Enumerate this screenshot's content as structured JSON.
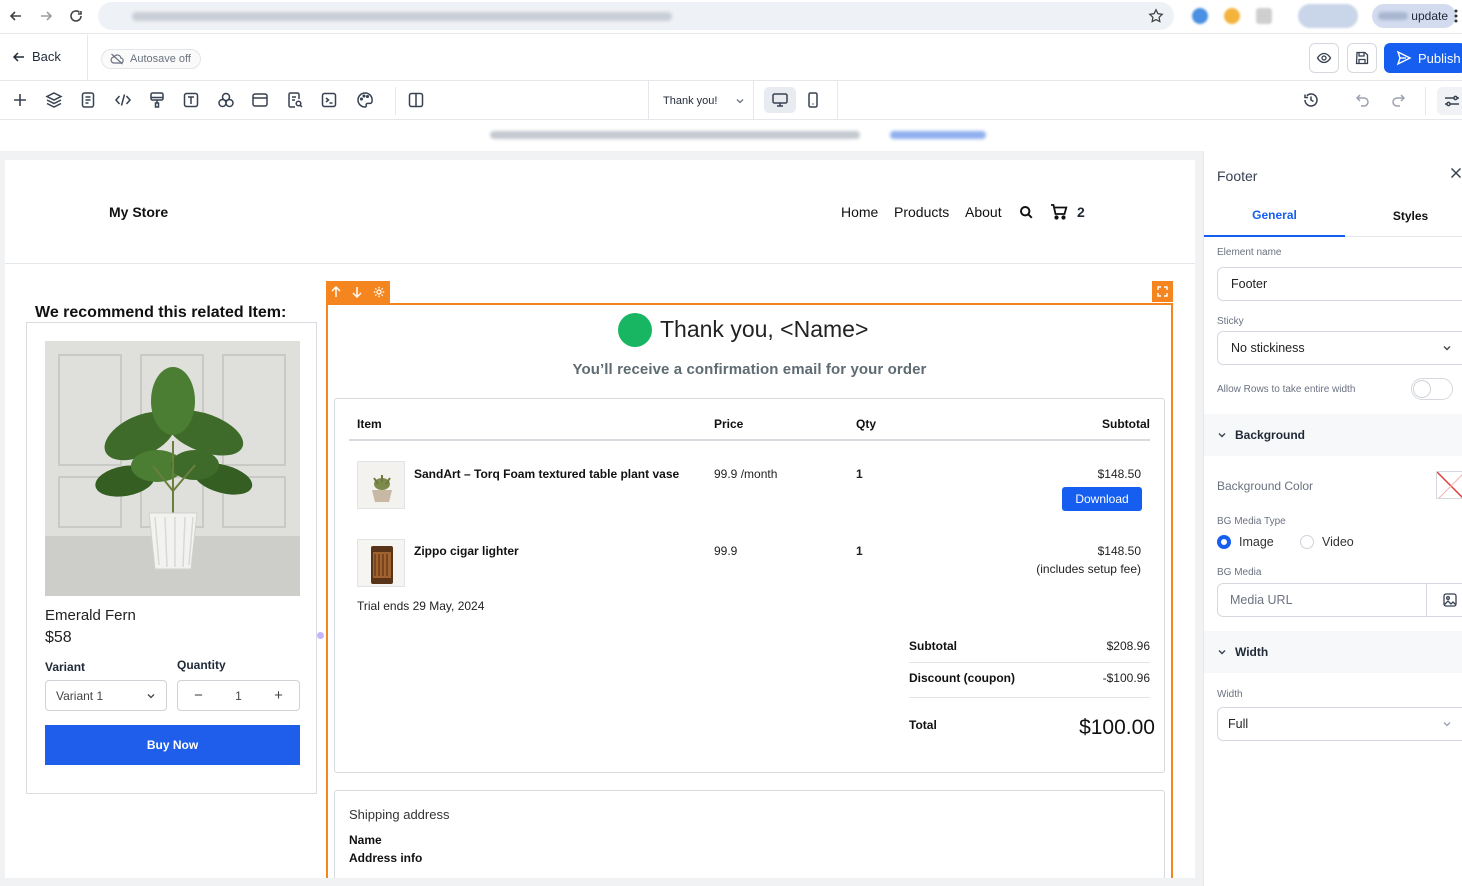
{
  "browser": {
    "update_label": "update"
  },
  "header": {
    "back_label": "Back",
    "autosave_label": "Autosave off",
    "publish_label": "Publish"
  },
  "toolbar": {
    "page_select": "Thank you!",
    "icons": [
      "plus-icon",
      "layers-icon",
      "pages-icon",
      "code-icon",
      "paint-icon",
      "text-icon",
      "elements-icon",
      "section-icon",
      "search-doc-icon",
      "terminal-icon",
      "palette-icon",
      "split-view-icon"
    ]
  },
  "site": {
    "store_name": "My Store",
    "nav": [
      "Home",
      "Products",
      "About"
    ],
    "cart_count": "2"
  },
  "recommendation": {
    "title": "We recommend this related Item:",
    "product_name": "Emerald Fern",
    "price": "$58",
    "variant_label": "Variant",
    "quantity_label": "Quantity",
    "variant_value": "Variant 1",
    "quantity_value": "1",
    "minus": "−",
    "plus": "+",
    "buy_label": "Buy Now"
  },
  "thankyou": {
    "title": "Thank you, <Name>",
    "subtitle": "You’ll receive a confirmation email for your order"
  },
  "order": {
    "headers": {
      "item": "Item",
      "price": "Price",
      "qty": "Qty",
      "subtotal": "Subtotal"
    },
    "rows": [
      {
        "name": "SandArt – Torq Foam textured table plant vase",
        "price": "99.9 /month",
        "qty": "1",
        "subtotal": "$148.50",
        "action": "Download"
      },
      {
        "name": "Zippo cigar lighter",
        "price": "99.9",
        "qty": "1",
        "subtotal": "$148.50",
        "note": "(includes setup fee)",
        "trial": "Trial ends 29 May, 2024"
      }
    ],
    "summary": {
      "subtotal_label": "Subtotal",
      "subtotal_value": "$208.96",
      "discount_label": "Discount (coupon)",
      "discount_value": "-$100.96",
      "total_label": "Total",
      "total_value": "$100.00"
    }
  },
  "shipping": {
    "title": "Shipping address",
    "name": "Name",
    "address": "Address info"
  },
  "panel": {
    "title": "Footer",
    "tabs": [
      "General",
      "Styles"
    ],
    "element_name_label": "Element name",
    "element_name_value": "Footer",
    "sticky_label": "Sticky",
    "sticky_value": "No stickiness",
    "allow_rows_label": "Allow Rows to take entire width",
    "allow_rows_on": false,
    "background_section": "Background",
    "bg_color_label": "Background Color",
    "bg_media_type_label": "BG Media Type",
    "media_types": [
      "Image",
      "Video"
    ],
    "media_type_selected": "Image",
    "bg_media_label": "BG Media",
    "media_url_placeholder": "Media URL",
    "width_section": "Width",
    "width_label": "Width",
    "width_value": "Full"
  },
  "colors": {
    "accent": "#155eef",
    "selection": "#f5861f",
    "success": "#18b663",
    "buy_button": "#1f5eea"
  }
}
